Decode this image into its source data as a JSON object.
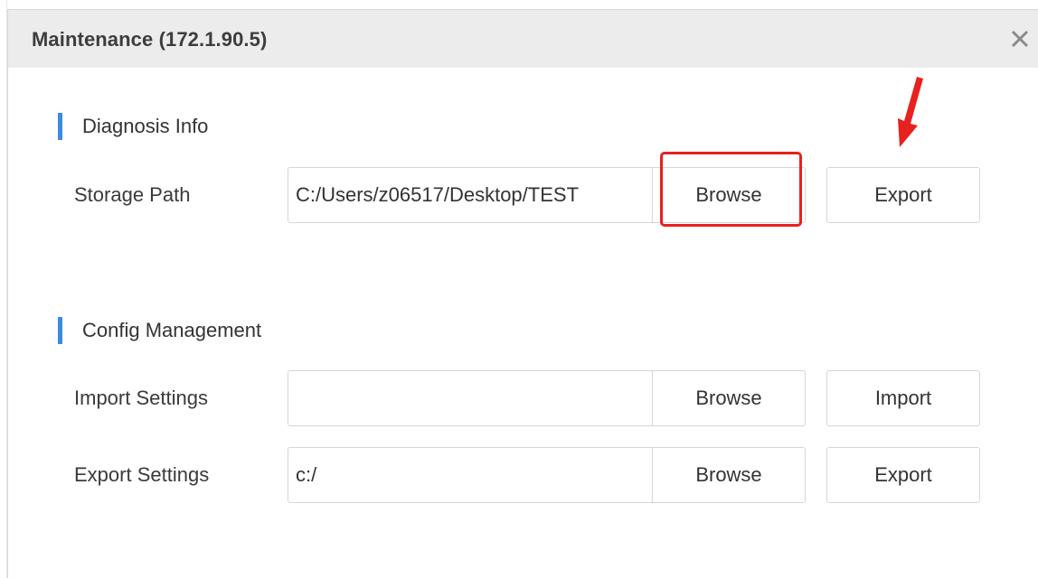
{
  "dialog": {
    "title": "Maintenance (172.1.90.5)",
    "close_icon": "close-icon"
  },
  "diagnosis": {
    "section_title": "Diagnosis Info",
    "storage_label": "Storage Path",
    "storage_path": "C:/Users/z06517/Desktop/TEST",
    "browse_label": "Browse",
    "export_label": "Export"
  },
  "config": {
    "section_title": "Config Management",
    "import_label": "Import Settings",
    "import_path": "",
    "import_browse_label": "Browse",
    "import_button_label": "Import",
    "export_label": "Export Settings",
    "export_path": "c:/",
    "export_browse_label": "Browse",
    "export_button_label": "Export"
  },
  "annotations": {
    "highlight_color": "#e8201e",
    "accent_color": "#3b8be3"
  }
}
